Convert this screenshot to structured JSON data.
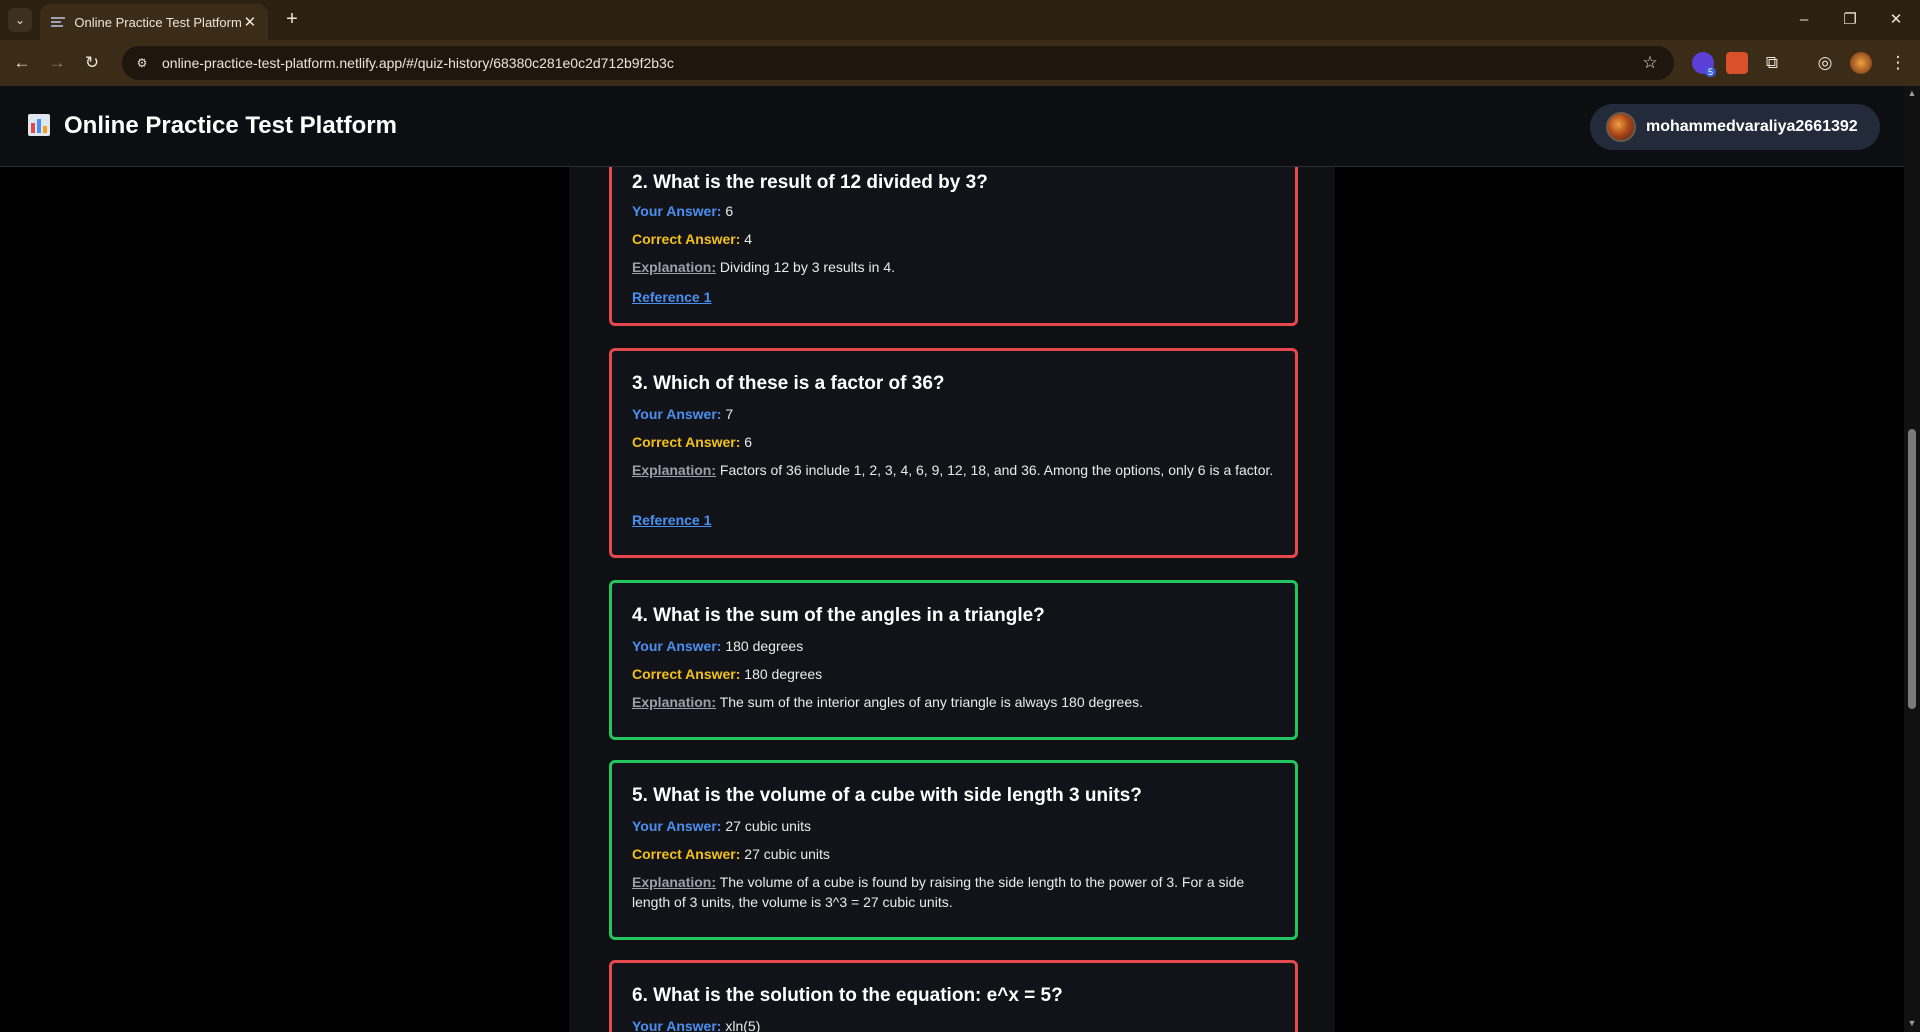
{
  "browser": {
    "tab_title": "Online Practice Test Platform",
    "url": "online-practice-test-platform.netlify.app/#/quiz-history/68380c281e0c2d712b9f2b3c",
    "extension_badge": "5"
  },
  "header": {
    "title": "Online Practice Test Platform",
    "username": "mohammedvaraliya2661392"
  },
  "labels": {
    "your_answer": "Your Answer:",
    "correct_answer": "Correct Answer:",
    "explanation": "Explanation:",
    "reference": "Reference 1"
  },
  "questions": [
    {
      "question": "2. What is the result of 12 divided by 3?",
      "your_answer": "6",
      "correct_answer": "4",
      "explanation": "Dividing 12 by 3 results in 4.",
      "status": "wrong"
    },
    {
      "question": "3. Which of these is a factor of 36?",
      "your_answer": "7",
      "correct_answer": "6",
      "explanation": "Factors of 36 include 1, 2, 3, 4, 6, 9, 12, 18, and 36. Among the options, only 6 is a factor.",
      "status": "wrong"
    },
    {
      "question": "4. What is the sum of the angles in a triangle?",
      "your_answer": "180 degrees",
      "correct_answer": "180 degrees",
      "explanation": "The sum of the interior angles of any triangle is always 180 degrees.",
      "status": "correct"
    },
    {
      "question": "5. What is the volume of a cube with side length 3 units?",
      "your_answer": "27 cubic units",
      "correct_answer": "27 cubic units",
      "explanation": "The volume of a cube is found by raising the side length to the power of 3. For a side length of 3 units, the volume is 3^3 = 27 cubic units.",
      "status": "correct"
    },
    {
      "question": "6. What is the solution to the equation: e^x = 5?",
      "your_answer": "xln(5)",
      "status": "wrong"
    }
  ]
}
